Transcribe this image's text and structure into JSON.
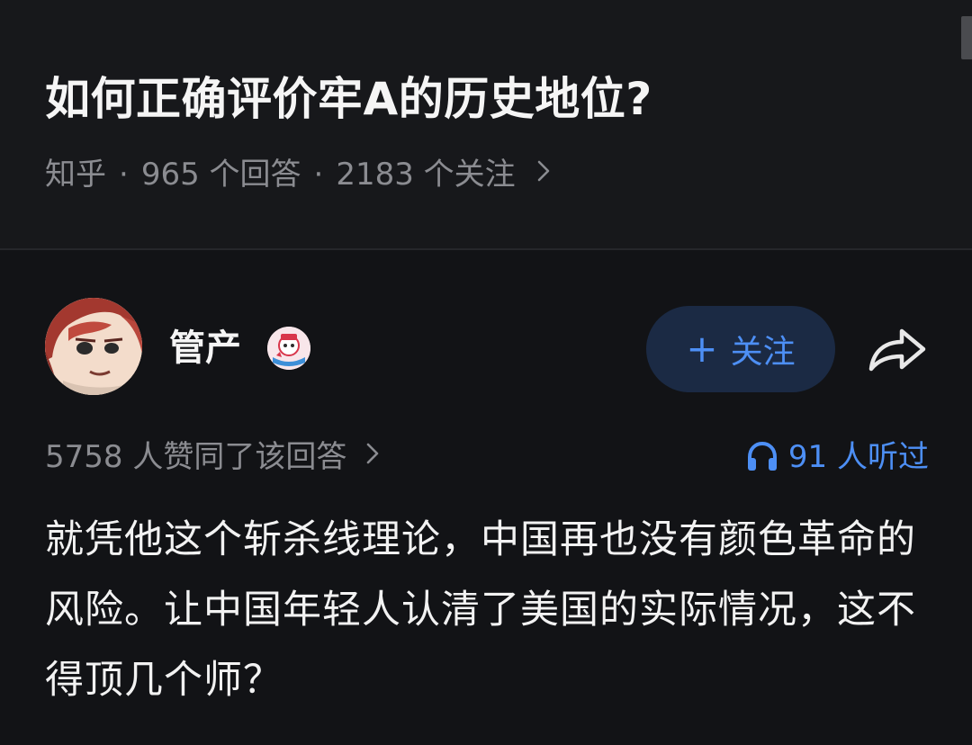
{
  "question": {
    "title": "如何正确评价牢A的历史地位?",
    "source": "知乎",
    "answers": "965 个回答",
    "followers": "2183 个关注",
    "separator": "·"
  },
  "answer": {
    "author": {
      "name": "管产"
    },
    "follow_button": {
      "plus": "+",
      "label": "关注"
    },
    "votes": "5758 人赞同了该回答",
    "listeners": "91 人听过",
    "content": "就凭他这个斩杀线理论，中国再也没有颜色革命的风险。让中国年轻人认清了美国的实际情况，这不得顶几个师？"
  },
  "icons": {
    "meta_chevron": "chevron-right-icon",
    "votes_chevron": "chevron-right-icon",
    "share": "share-arrow-icon",
    "listen": "headphones-icon",
    "badge": "creator-badge-icon"
  },
  "colors": {
    "background": "#121316",
    "header_background": "#17181b",
    "text_primary": "#f2f2f2",
    "text_secondary": "#8b8c91",
    "accent": "#4d8ff5",
    "follow_bg": "#1b2a44"
  }
}
